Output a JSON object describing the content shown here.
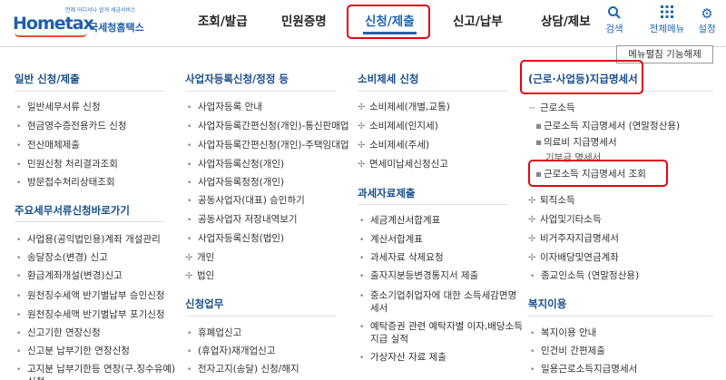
{
  "logo": {
    "sub": "언제 어디서나 쉽게 세금서비스",
    "main": "Hometax",
    "ko": "국세청홈택스"
  },
  "gnb": [
    "조회/발급",
    "민원증명",
    "신청/제출",
    "신고/납부",
    "상담/제보"
  ],
  "util": [
    {
      "icon": "search-icon",
      "label": "검색"
    },
    {
      "icon": "grid-icon",
      "label": "전체메뉴"
    },
    {
      "icon": "gear-icon",
      "label": "설정"
    }
  ],
  "collapse_label": "메뉴펼침 기능해제",
  "col1": {
    "sections": [
      {
        "title": "일반 신청/제출",
        "items": [
          "일반세무서류 신청",
          "현금영수증전용카드 신청",
          "전산매체제출",
          "민원신청 처리결과조회",
          "방문접수처리상태조회"
        ]
      },
      {
        "title": "주요세무서류신청바로가기",
        "items": [
          "사업용(공익법인용)계좌 개설관리",
          "송달장소(변경) 신고",
          "환급계좌개설(변경)신고",
          "원천징수세액 반기별납부 승인신청",
          "원천징수세액 반기별납부 포기신청",
          "신고기한 연장신청",
          "신고분 납부기한 연장신청",
          "고지분 납부기한등 연장(구.징수유예)",
          "신청"
        ]
      }
    ]
  },
  "col2": {
    "sections": [
      {
        "title": "사업자등록신청/정정 등",
        "items": [
          "사업자등록 안내",
          "사업자등록간편신청(개인)-통신판매업",
          "사업자등록간편신청(개인)-주택임대업",
          "사업자등록신청(개인)",
          "사업자등록정정(개인)",
          "공동사업자(대표) 승인하기",
          "공동사업자 저장내역보기",
          "사업자등록신청(법인)",
          "개인",
          "법인"
        ]
      },
      {
        "title": "신청업무",
        "items": [
          "휴폐업신고",
          "(휴업자)재개업신고",
          "전자고지(송달) 신청/해지"
        ]
      }
    ]
  },
  "col3": {
    "sections": [
      {
        "title": "소비제세 신청",
        "items": [
          "소비제세(개별,교통)",
          "소비제세(인지세)",
          "소비제세(주세)",
          "면세미납세신청신고"
        ]
      },
      {
        "title": "과세자료제출",
        "items": [
          "세금계산서합계표",
          "계산서합계표",
          "과세자료 삭제요청",
          "출자지분등변경통지서 제출",
          "중소기업취업자에 대한 소득세감면명",
          "세서",
          "예탁증권 관련 예탁자별 이자,배당소득",
          "지급 실적",
          "가상자산 자료 제출"
        ]
      }
    ]
  },
  "col4": {
    "sections": [
      {
        "title": "(근로·사업등)지급명세서",
        "items": [
          "근로소득",
          "근로소득 지급명세서 (연말정산용)",
          "의료비 지급명세서",
          "기부금 명세서",
          "근로소득 지급명세서 조회",
          "퇴직소득",
          "사업및기타소득",
          "비거주자지급명세서",
          "이자배당및연금계좌",
          "종교인소득 (연말정산용)"
        ]
      },
      {
        "title": "복지이용",
        "items": [
          "복지이용 안내",
          "인건비 간편제출",
          "일용근로소득지급명세서"
        ]
      }
    ]
  }
}
